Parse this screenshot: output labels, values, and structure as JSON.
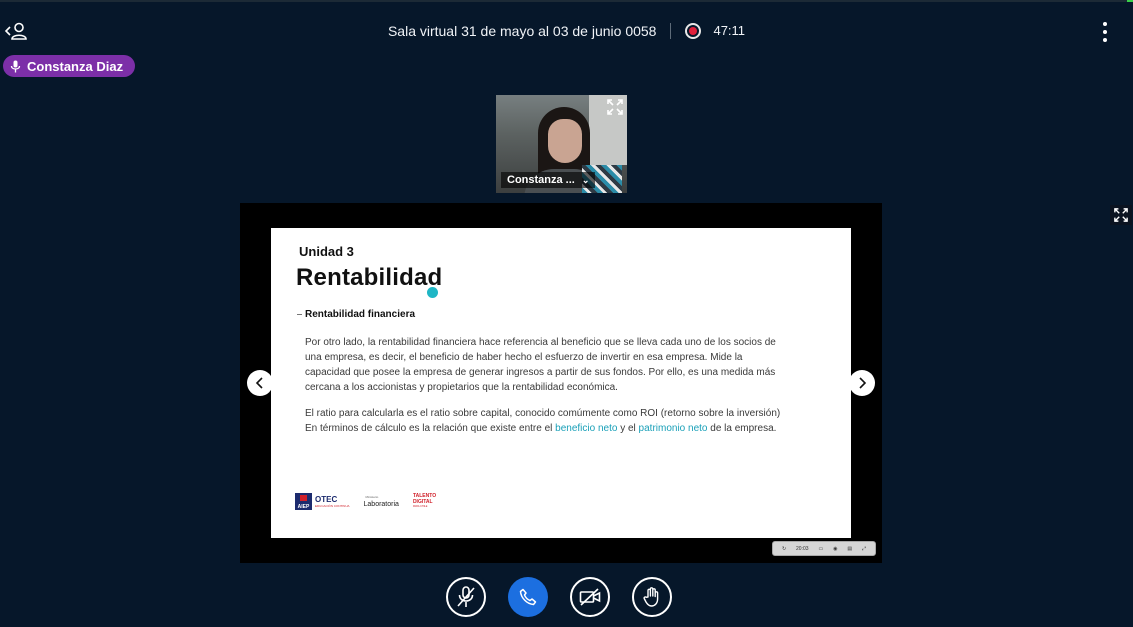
{
  "header": {
    "meeting_title": "Sala virtual 31 de mayo al 03 de junio 0058",
    "recording_time": "47:11"
  },
  "talking_indicator": {
    "name": "Constanza Diaz"
  },
  "webcam": {
    "name": "Constanza ..."
  },
  "slide": {
    "unit": "Unidad 3",
    "title": "Rentabilidad",
    "subtitle": "Rentabilidad financiera",
    "paragraph1": "Por otro lado, la rentabilidad financiera hace referencia al beneficio que se lleva cada uno de los socios de una empresa, es decir, el beneficio de haber hecho el esfuerzo de invertir en esa empresa. Mide la capacidad que posee la empresa de generar ingresos a partir de sus fondos. Por ello, es una medida más cercana a los accionistas y propietarios que la rentabilidad económica.",
    "paragraph2_part1": "El ratio para calcularla es el ratio sobre capital, conocido comúmente como ROI (retorno sobre la inversión)  En términos de cálculo es la relación que existe entre el ",
    "paragraph2_link1": "beneficio neto",
    "paragraph2_part2": " y el ",
    "paragraph2_link2": "patrimonio neto",
    "paragraph2_part3": " de la empresa.",
    "logos": {
      "aiep": "AIEP",
      "otec": "OTEC",
      "otec_sub": "EDUCACIÓN CONTINUA",
      "laboratoria_small": "Ministerio",
      "laboratoria": "Laboratoria",
      "talento": "TALENTO DIGITAL",
      "talento_sub": "PARA CHILE"
    }
  },
  "mini_toolbar": {
    "time": "20:03"
  },
  "colors": {
    "background": "#06172a",
    "talker_badge": "#7c2fa8",
    "hangup": "#1c6fe0",
    "record": "#e0203a",
    "link": "#1aa0b8"
  },
  "icons": {
    "users": "users-icon",
    "record": "record-icon",
    "menu": "kebab-menu-icon",
    "mic": "microphone-icon",
    "fullscreen": "fullscreen-icon",
    "prev": "chevron-left-icon",
    "next": "chevron-right-icon",
    "mute": "microphone-off-icon",
    "hangup": "phone-icon",
    "camera_off": "camera-off-icon",
    "raise_hand": "raise-hand-icon"
  }
}
